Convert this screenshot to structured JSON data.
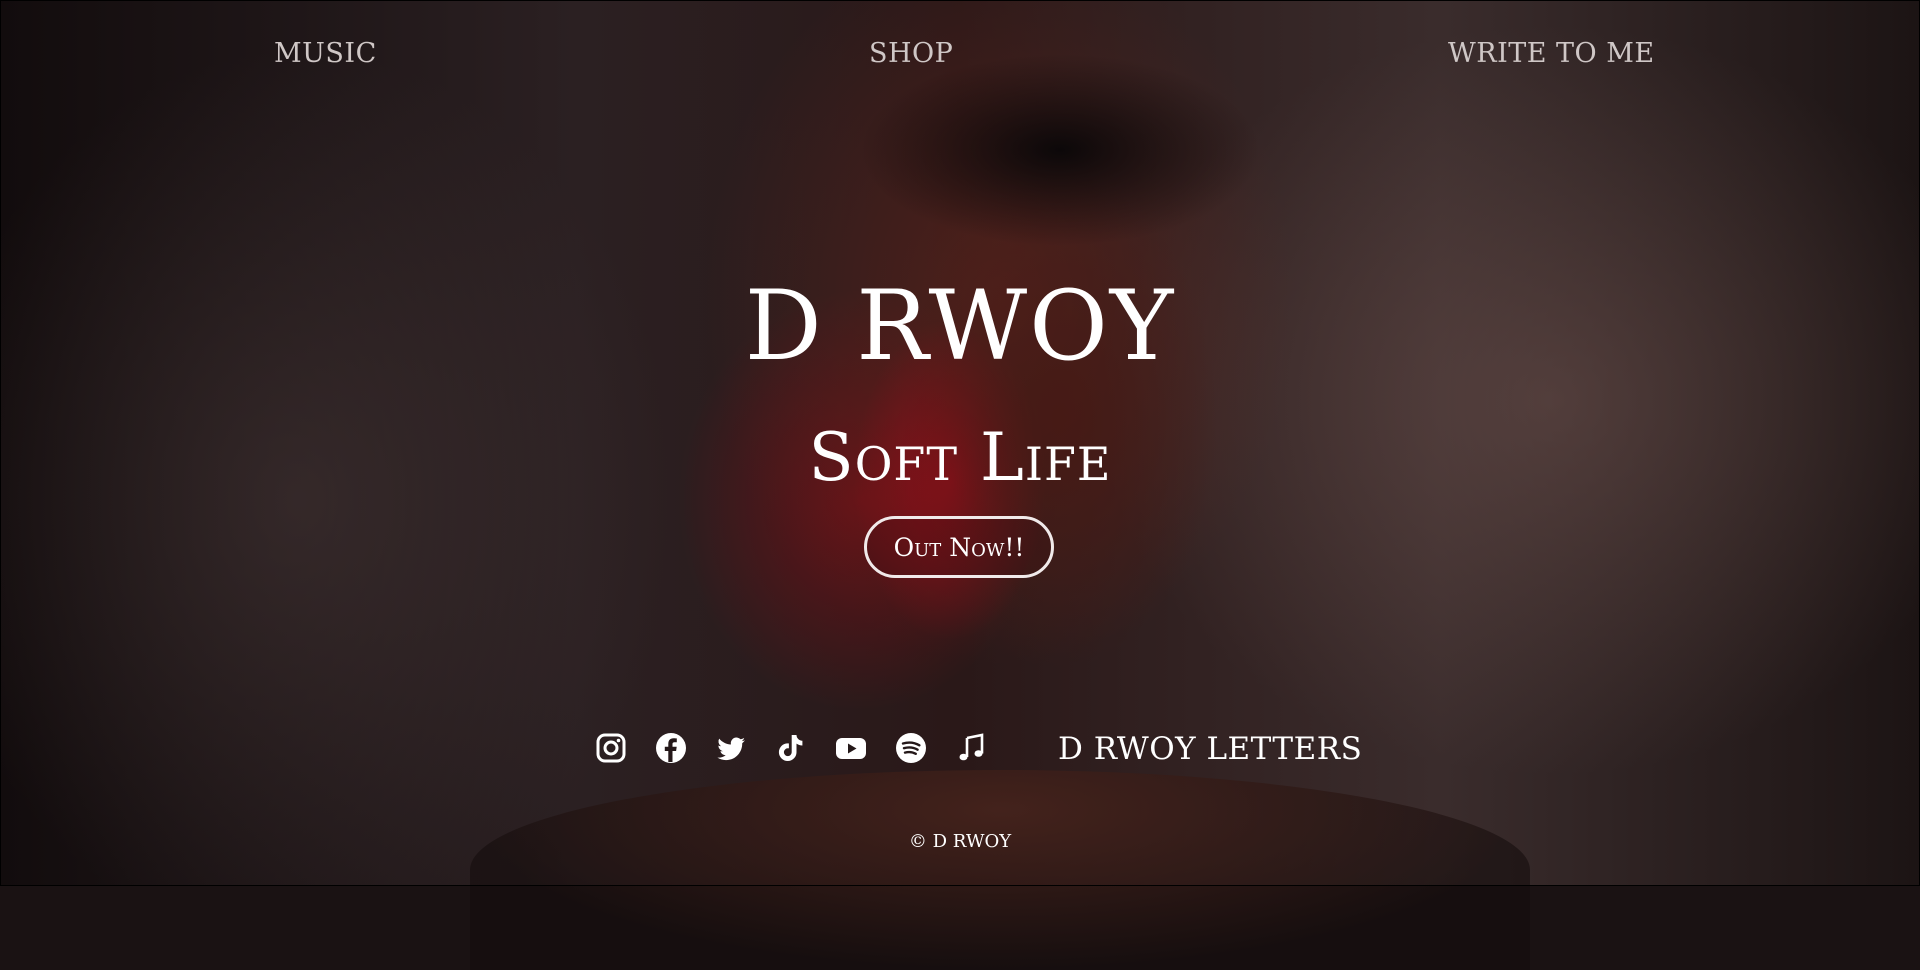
{
  "nav": {
    "music": "MUSIC",
    "shop": "SHOP",
    "write": "WRITE TO ME"
  },
  "hero": {
    "title": "D RWOY",
    "subtitle": "Soft Life",
    "cta_label": "Out Now!!"
  },
  "socials": {
    "icons": [
      "instagram-icon",
      "facebook-icon",
      "twitter-icon",
      "tiktok-icon",
      "youtube-icon",
      "spotify-icon",
      "apple-music-icon"
    ],
    "letters_link": "D RWOY LETTERS"
  },
  "footer": {
    "copyright": "© D RWOY"
  },
  "colors": {
    "text": "#ffffff",
    "nav_text": "#cfc7c6",
    "background": "#1a1213"
  }
}
